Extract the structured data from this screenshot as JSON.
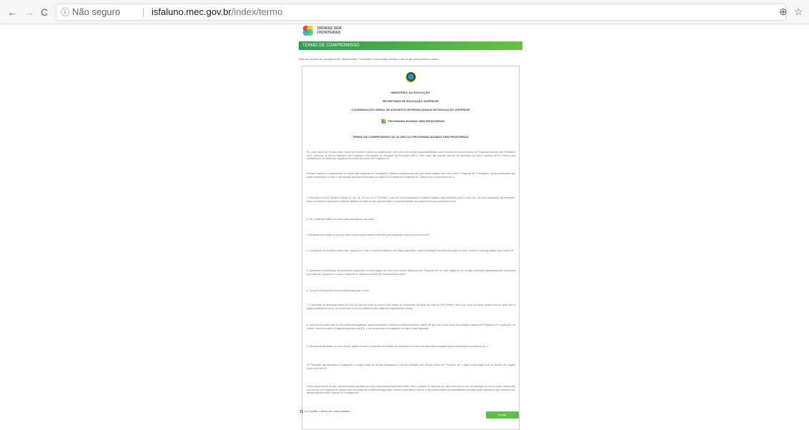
{
  "browser": {
    "back_icon": "←",
    "forward_icon": "→",
    "reload_icon": "C",
    "info_icon": "ⓘ",
    "security_label": "Não seguro",
    "url_host": "isfaluno.mec.gov.br",
    "url_path": "/index/termo",
    "zoom_icon": "⊕",
    "star_icon": "☆"
  },
  "brand": {
    "logo_text_line1": "IDIOMAS SEM",
    "logo_text_line2": "FRONTEIRAS",
    "colors": {
      "banner_start": "#2e9e55",
      "banner_end": "#68c23f",
      "button": "#5fbf4a"
    }
  },
  "banner": {
    "title": "TERMO DE COMPROMISSO"
  },
  "intro": "Para ter acesso ao programa IsF Idiomas sem Fronteiras é necessário aceitar o termo de compromisso abaixo.",
  "document": {
    "ministry": "MINISTÉRIO DA EDUCAÇÃO",
    "secretariat": "SECRETARIA DE EDUCAÇÃO SUPERIOR",
    "coordination": "COORDENAÇÃO GERAL DE ASSUNTOS INTERNACIONAIS DE EDUCAÇÃO SUPERIOR",
    "program": "PROGRAMA IDIOMAS SEM FRONTEIRAS",
    "title": "TERMO DE COMPROMISSO DO ALUNO DO PROGRAMA IDIOMAS SEM FRONTEIRAS",
    "paragraphs": [
      "Eu, como aluno (a), declaro estar ciente das normas e diretrizes institucionais, bem como de minhas responsabilidades como membro do corpo discente do Programa Idiomas sem Fronteiras (IsF), conforme os termos definidos nas Portarias e Resoluções do Ministério da Educação (MEC), bem como das normas internas da instituição de ensino superior (IES) e termo para conhecimento do Edital que regulamenta a oferta de cursos do Programa IsF.",
      "Portanto, assumo o compromisso de seguir rigorosamente as orientações e pedidos institucionais para que possa realizar meu curso com o Programa IsF e assegurar minha participação nas aulas presenciais e on-line e nas demais atividades oferecidas por cada IES no âmbito do Programa IsF. Desta forma, comprometo-me a:",
      "1. Respeitar a Lei de Direitos Autorais (cf. Art. 46, VIII da Lei nº 9.610/98) e usar de forma responsável o material didático disponibilizado para o curso (ex.: não tirar fotocópias, não escanear, fazer download ou reproduzir o material utilizado em sala de aula que excedam a proporcionalidade de pequenos trechos permitida em lei).",
      "2. Ter o material didático em mãos para participação nas aulas.",
      "3. Respeitar seu código de postura, ética e bom comportamento definidos pela legislação específica de minha IES.",
      "4. Comparecer às reuniões presenciais, quando for o caso e conforme definido nos editais específicos, para confirmação de minha inscrição no curso, horário e local agendados pelo núcleo IsF.",
      "5. Apresentar a certificação de proficiência linguística mínima exigida, por meio dos exames definidos pelo Programa IsF em meio digital ou em reunião presencial especificamente convocada para esse fim, quando for o caso e conforme for disposto no edital que regulamenta a oferta.",
      "6. Cumprir a frequência mínima estabelecida para o curso.",
      "7. Compensar as ausências acima de 25% do total de horas do curso e não deixar de comparecer às aulas por mais de 25% (vinte e cinco) por cento da carga horária total do curso sem a devida justificativa formal, de acordo com os termos definidos pelo edital que regulamenta a oferta.",
      "8. Inscrever-me para teste (s) de proficiência linguística, quando solicitado e previsto no edital respectivo, diante de que este é uma forma de avaliação nacional do Programa IsF. A aplicação, se houver, ocorrerá a partir de agenda proposta pela IES, e me comprometo a comparecer na data e local indicados.",
      "9. Realizar as atividades do curso virtual, quando houver, e participar de sessões de monitoria ao acordo com calendário divulgado pela coordenação do professor (a), e.",
      "10. Participar das atividades e avaliações e cumprir todas as demais orientações e normas definidas pelo Núcleo Gestor do Programa IsF e pela Coordenação local do Núcleo de Línguas (NucLi-IsF) da IES.",
      "Tenho pleno ciência de que, caso descumpra qualquer um dos compromissos assumidos neste Termo, poderei ser impedido (a), pelo prazo de um ano, de participar de novos cursos presenciais e/ou on-line do Programa IsF, assim como dos testes de proficiência linguística, inclusive para efeitos futuros, o que poderá afetar as possibilidades previstas pelas instituições que venham a ser designadas pelo corpo docente do Programa IsF."
    ]
  },
  "footer": {
    "checkbox_label": "Li e aceito o termo de compromisso",
    "submit_label": "Enviar"
  }
}
